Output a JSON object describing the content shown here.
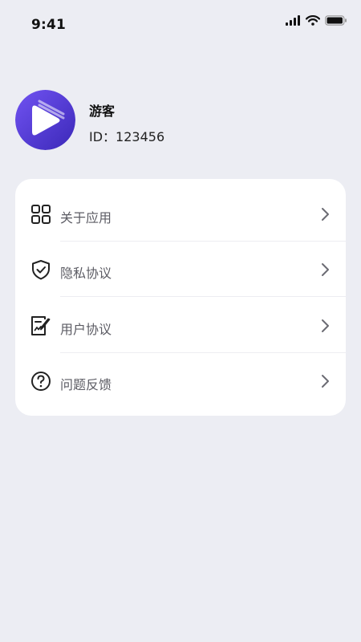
{
  "status_bar": {
    "time": "9:41",
    "icons": [
      "signal-icon",
      "wifi-icon",
      "battery-icon"
    ]
  },
  "profile": {
    "name": "游客",
    "id_text": "ID：123456",
    "avatar_colors": {
      "from": "#6a4cf0",
      "to": "#3f2bbf"
    }
  },
  "menu": {
    "items": [
      {
        "label": "关于应用",
        "icon": "grid-icon"
      },
      {
        "label": "隐私协议",
        "icon": "shield-check-icon"
      },
      {
        "label": "用户协议",
        "icon": "contract-pen-icon"
      },
      {
        "label": "问题反馈",
        "icon": "question-circle-icon"
      }
    ]
  },
  "colors": {
    "background": "#ecedf3",
    "card": "#ffffff",
    "label": "#5c5c64",
    "chevron": "#6b6b73"
  }
}
